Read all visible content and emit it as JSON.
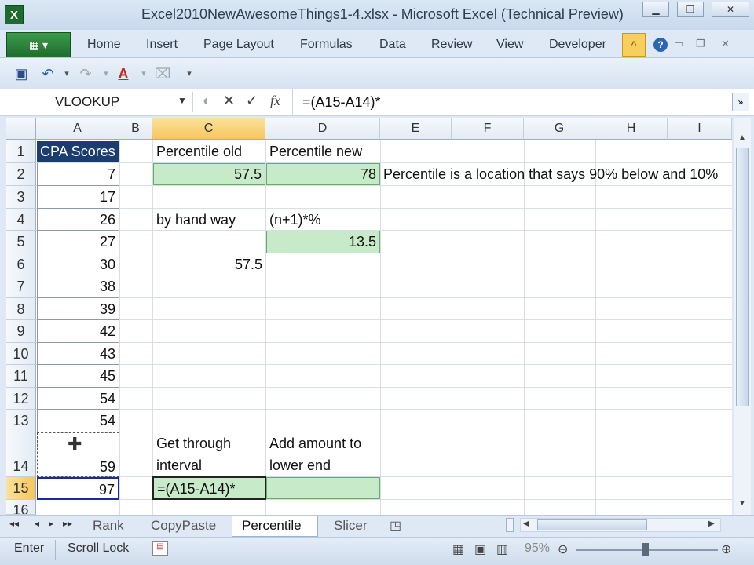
{
  "window": {
    "title": "Excel2010NewAwesomeThings1-4.xlsx   -   Microsoft Excel (Technical Preview)"
  },
  "ribbon": {
    "file_label": "▦ ▾",
    "tabs": [
      "Home",
      "Insert",
      "Page Layout",
      "Formulas",
      "Data",
      "Review",
      "View",
      "Developer"
    ]
  },
  "formula_bar": {
    "name_box": "VLOOKUP",
    "formula": "=(A15-A14)*",
    "fx_label": "fx"
  },
  "columns": [
    "A",
    "B",
    "C",
    "D",
    "E",
    "F",
    "G",
    "H",
    "I"
  ],
  "rows": [
    "1",
    "2",
    "3",
    "4",
    "5",
    "6",
    "7",
    "8",
    "9",
    "10",
    "11",
    "12",
    "13",
    "14",
    "15",
    "16"
  ],
  "cells": {
    "A1": "CPA Scores",
    "A2": "7",
    "A3": "17",
    "A4": "26",
    "A5": "27",
    "A6": "30",
    "A7": "38",
    "A8": "39",
    "A9": "42",
    "A10": "43",
    "A11": "45",
    "A12": "54",
    "A13": "54",
    "A14": "59",
    "A15": "97",
    "C1": "Percentile old",
    "D1": "Percentile new",
    "C2": "57.5",
    "D2": "78",
    "E2": "Percentile is a location that says 90% below and 10%",
    "C4": "by hand way",
    "D4": "(n+1)*%",
    "D5": "13.5",
    "C6": "57.5",
    "C14a": "Get through",
    "C14b": "interval",
    "D14a": "Add amount to",
    "D14b": "lower end",
    "C15": "=(A15-A14)*"
  },
  "sheet_tabs": [
    "Rank",
    "CopyPaste",
    "Percentile",
    "Slicer"
  ],
  "active_sheet": "Percentile",
  "status": {
    "mode": "Enter",
    "scroll_lock": "Scroll Lock",
    "zoom": "95%"
  },
  "colors": {
    "accent": "#1f6e2e",
    "selection": "#f6c65b",
    "green_fill": "#c7eac8",
    "header_fill": "#1a3c6e"
  }
}
